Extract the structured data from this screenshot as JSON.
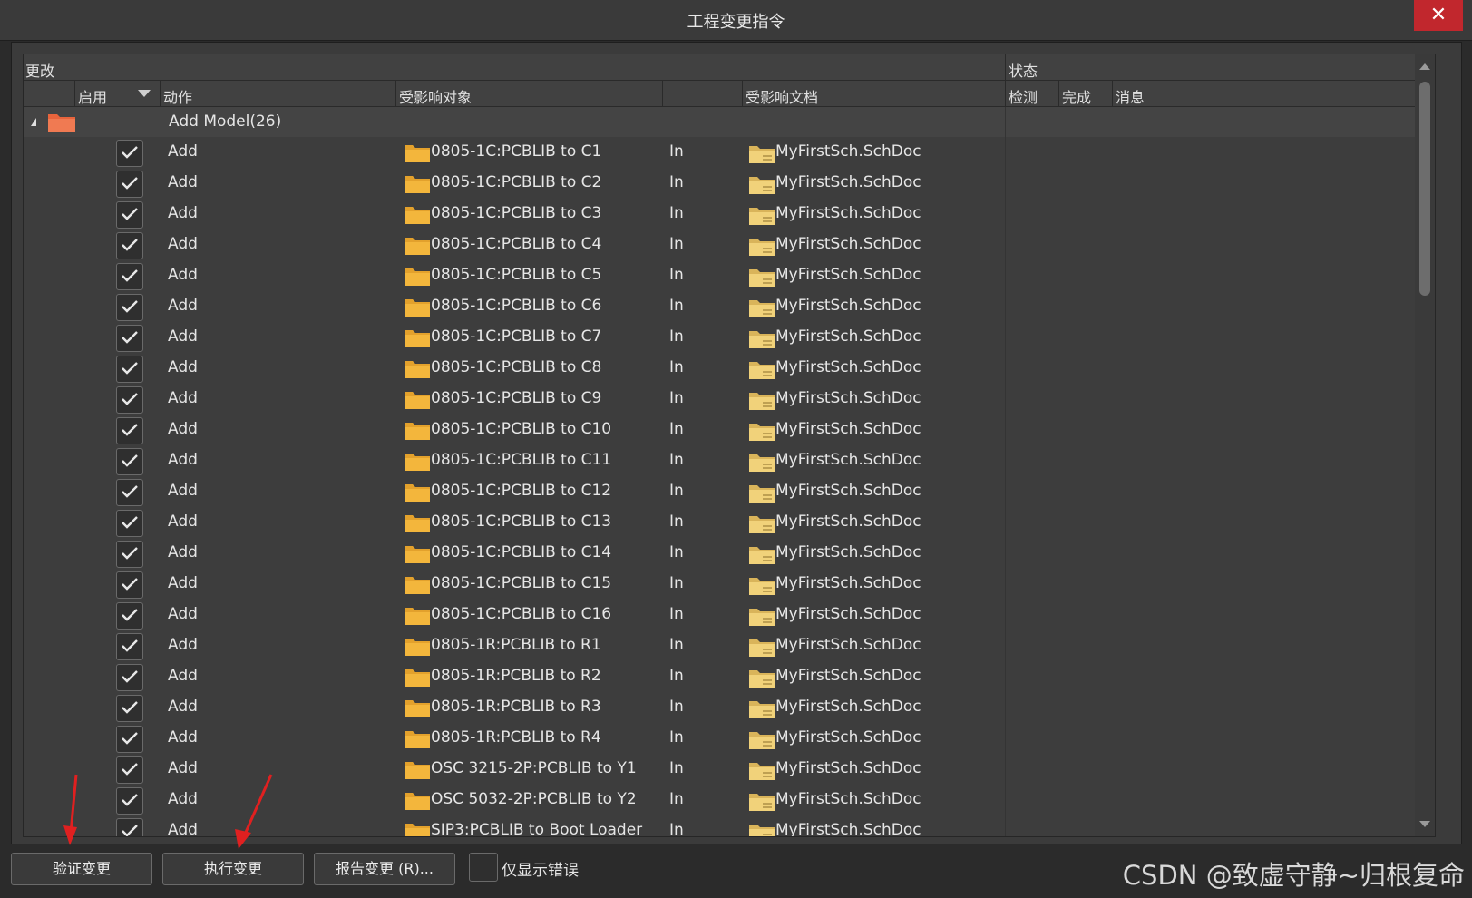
{
  "window": {
    "title": "工程变更指令",
    "close_label": "✕"
  },
  "header": {
    "group_changes": "更改",
    "group_status": "状态",
    "col_enable": "启用",
    "col_action": "动作",
    "col_object": "受影响对象",
    "col_document": "受影响文档",
    "col_check": "检测",
    "col_done": "完成",
    "col_message": "消息"
  },
  "group": {
    "label": "Add Model(26)"
  },
  "rows": [
    {
      "action": "Add",
      "object": "0805-1C:PCBLIB to C1",
      "in": "In",
      "doc": "MyFirstSch.SchDoc"
    },
    {
      "action": "Add",
      "object": "0805-1C:PCBLIB to C2",
      "in": "In",
      "doc": "MyFirstSch.SchDoc"
    },
    {
      "action": "Add",
      "object": "0805-1C:PCBLIB to C3",
      "in": "In",
      "doc": "MyFirstSch.SchDoc"
    },
    {
      "action": "Add",
      "object": "0805-1C:PCBLIB to C4",
      "in": "In",
      "doc": "MyFirstSch.SchDoc"
    },
    {
      "action": "Add",
      "object": "0805-1C:PCBLIB to C5",
      "in": "In",
      "doc": "MyFirstSch.SchDoc"
    },
    {
      "action": "Add",
      "object": "0805-1C:PCBLIB to C6",
      "in": "In",
      "doc": "MyFirstSch.SchDoc"
    },
    {
      "action": "Add",
      "object": "0805-1C:PCBLIB to C7",
      "in": "In",
      "doc": "MyFirstSch.SchDoc"
    },
    {
      "action": "Add",
      "object": "0805-1C:PCBLIB to C8",
      "in": "In",
      "doc": "MyFirstSch.SchDoc"
    },
    {
      "action": "Add",
      "object": "0805-1C:PCBLIB to C9",
      "in": "In",
      "doc": "MyFirstSch.SchDoc"
    },
    {
      "action": "Add",
      "object": "0805-1C:PCBLIB to C10",
      "in": "In",
      "doc": "MyFirstSch.SchDoc"
    },
    {
      "action": "Add",
      "object": "0805-1C:PCBLIB to C11",
      "in": "In",
      "doc": "MyFirstSch.SchDoc"
    },
    {
      "action": "Add",
      "object": "0805-1C:PCBLIB to C12",
      "in": "In",
      "doc": "MyFirstSch.SchDoc"
    },
    {
      "action": "Add",
      "object": "0805-1C:PCBLIB to C13",
      "in": "In",
      "doc": "MyFirstSch.SchDoc"
    },
    {
      "action": "Add",
      "object": "0805-1C:PCBLIB to C14",
      "in": "In",
      "doc": "MyFirstSch.SchDoc"
    },
    {
      "action": "Add",
      "object": "0805-1C:PCBLIB to C15",
      "in": "In",
      "doc": "MyFirstSch.SchDoc"
    },
    {
      "action": "Add",
      "object": "0805-1C:PCBLIB to C16",
      "in": "In",
      "doc": "MyFirstSch.SchDoc"
    },
    {
      "action": "Add",
      "object": "0805-1R:PCBLIB to R1",
      "in": "In",
      "doc": "MyFirstSch.SchDoc"
    },
    {
      "action": "Add",
      "object": "0805-1R:PCBLIB to R2",
      "in": "In",
      "doc": "MyFirstSch.SchDoc"
    },
    {
      "action": "Add",
      "object": "0805-1R:PCBLIB to R3",
      "in": "In",
      "doc": "MyFirstSch.SchDoc"
    },
    {
      "action": "Add",
      "object": "0805-1R:PCBLIB to R4",
      "in": "In",
      "doc": "MyFirstSch.SchDoc"
    },
    {
      "action": "Add",
      "object": "OSC 3215-2P:PCBLIB to Y1",
      "in": "In",
      "doc": "MyFirstSch.SchDoc"
    },
    {
      "action": "Add",
      "object": "OSC 5032-2P:PCBLIB to Y2",
      "in": "In",
      "doc": "MyFirstSch.SchDoc"
    },
    {
      "action": "Add",
      "object": "SIP3:PCBLIB to Boot Loader",
      "in": "In",
      "doc": "MyFirstSch.SchDoc"
    }
  ],
  "footer": {
    "validate_label": "验证变更",
    "execute_label": "执行变更",
    "report_label": "报告变更 (R)...",
    "only_errors_label": "仅显示错误",
    "watermark": "CSDN @致虚守静~归根复命"
  },
  "colors": {
    "accent_close": "#c1272d",
    "folder": "#f3b63c",
    "group_folder": "#e8643c",
    "arrow": "#e02020"
  },
  "icons": [
    "close-icon",
    "expand-icon",
    "folder-icon",
    "document-icon",
    "check-icon",
    "sort-icon",
    "scroll-up-icon",
    "scroll-down-icon",
    "arrow-icon"
  ]
}
